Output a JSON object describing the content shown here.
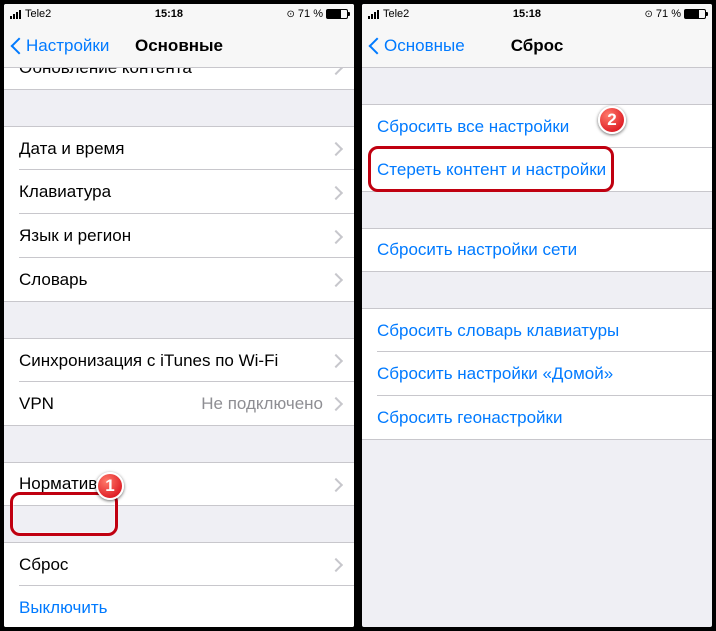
{
  "status": {
    "carrier": "Tele2",
    "time": "15:18",
    "battery_pct": "71 %"
  },
  "left": {
    "back_label": "Настройки",
    "title": "Основные",
    "row_update": "Обновление контента",
    "row_datetime": "Дата и время",
    "row_keyboard": "Клавиатура",
    "row_lang": "Язык и регион",
    "row_dict": "Словарь",
    "row_itunes": "Синхронизация с iTunes по Wi-Fi",
    "row_vpn": "VPN",
    "row_vpn_detail": "Не подключено",
    "row_norm": "Нормативы",
    "row_reset": "Сброс",
    "row_shutdown": "Выключить",
    "callout": "1"
  },
  "right": {
    "back_label": "Основные",
    "title": "Сброс",
    "row_reset_all": "Сбросить все настройки",
    "row_erase": "Стереть контент и настройки",
    "row_reset_net": "Сбросить настройки сети",
    "row_reset_dict": "Сбросить словарь клавиатуры",
    "row_reset_home": "Сбросить настройки «Домой»",
    "row_reset_geo": "Сбросить геонастройки",
    "callout": "2"
  }
}
